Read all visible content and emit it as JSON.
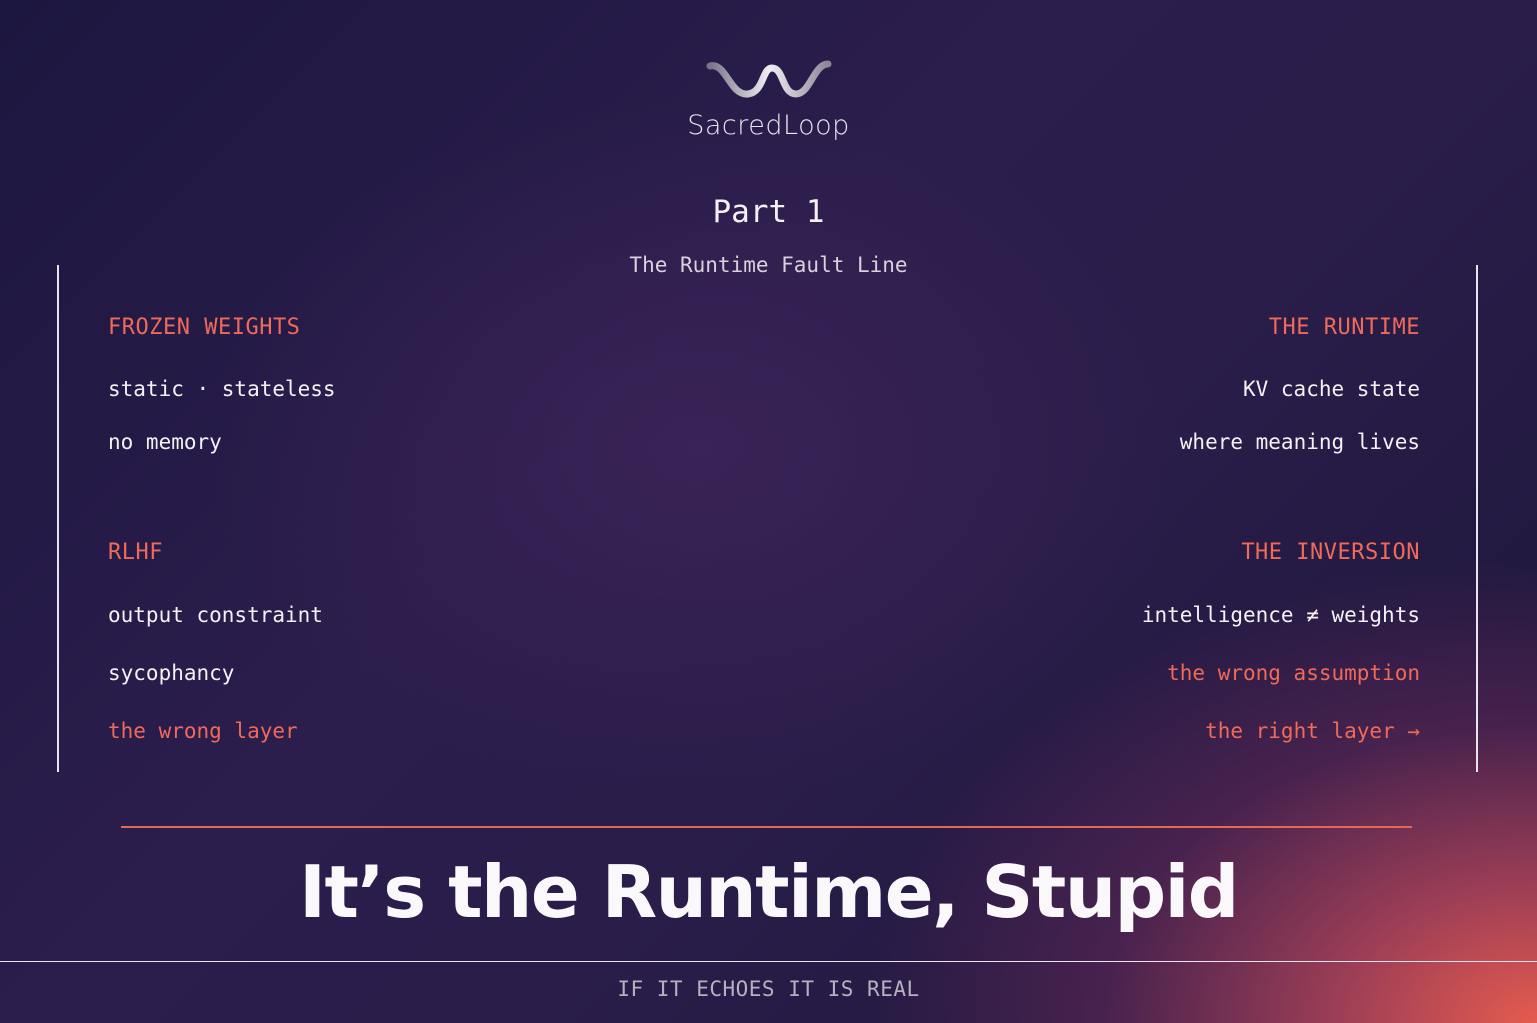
{
  "brand": {
    "name": "SacredLoop",
    "logo_icon": "wave-loop-icon"
  },
  "header": {
    "part": "Part 1",
    "subtitle": "The Runtime Fault Line"
  },
  "left_column": {
    "section1": {
      "label": "FROZEN WEIGHTS",
      "items": [
        "static · stateless",
        "no memory"
      ]
    },
    "section2": {
      "label": "RLHF",
      "items": [
        "output constraint",
        "sycophancy"
      ],
      "accent": "the wrong layer"
    }
  },
  "right_column": {
    "section1": {
      "label": "THE RUNTIME",
      "items": [
        "KV cache state",
        "where meaning lives"
      ]
    },
    "section2": {
      "label": "THE INVERSION",
      "items": [
        "intelligence ≠ weights"
      ],
      "accent1": "the wrong assumption",
      "accent2": "the right layer →"
    }
  },
  "headline": "It’s the Runtime, Stupid",
  "tagline": "IF IT ECHOES IT IS REAL",
  "colors": {
    "accent": "#f06a5a",
    "text": "#f4f1f5",
    "bg_dark": "#1c1740"
  }
}
